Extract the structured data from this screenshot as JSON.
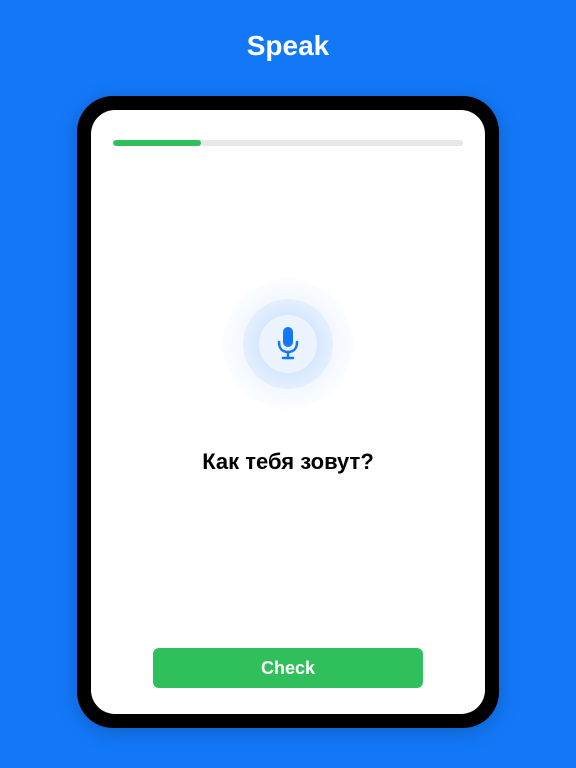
{
  "header": {
    "title": "Speak"
  },
  "lesson": {
    "progress_percent": 25,
    "prompt_text": "Как тебя зовут?",
    "check_label": "Check"
  },
  "icons": {
    "mic": "microphone-icon"
  },
  "colors": {
    "background": "#1378f8",
    "progress_fill": "#2fbf5b",
    "button": "#2fbf5b"
  }
}
